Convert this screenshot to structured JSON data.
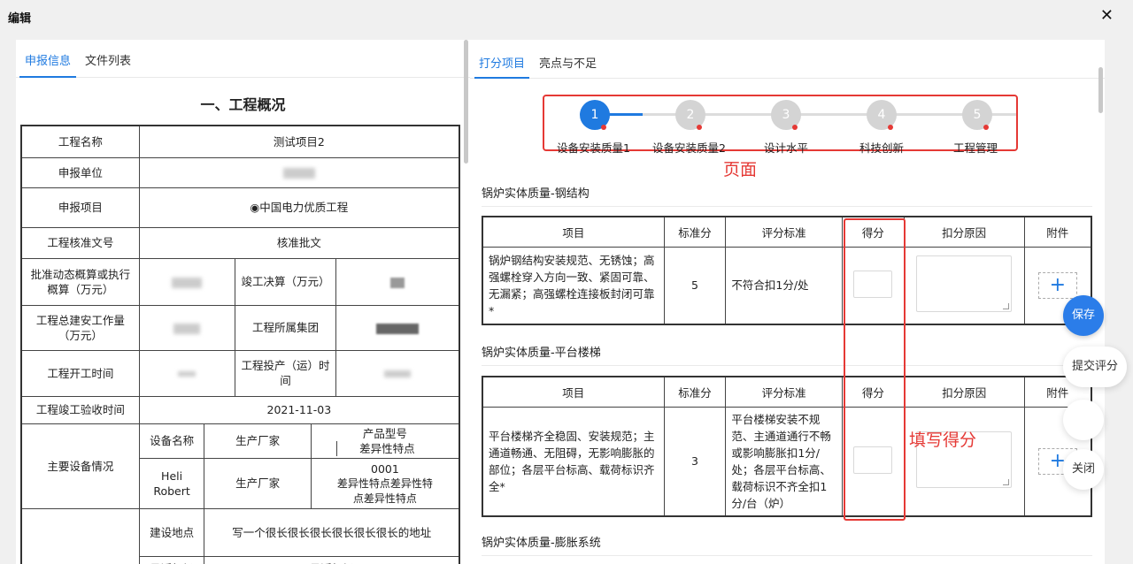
{
  "window": {
    "title": "编辑",
    "close_symbol": "✕"
  },
  "left": {
    "tabs": [
      "申报信息",
      "文件列表"
    ],
    "section_title": "一、工程概况",
    "rows": {
      "project_name_label": "工程名称",
      "project_name_value": "测试项目2",
      "unit_label": "申报单位",
      "item_label": "申报项目",
      "item_value": "◉中国电力优质工程",
      "doc_label": "工程核准文号",
      "doc_value": "核准批文",
      "budget_label": "批准动态概算或执行概算（万元）",
      "final_label": "竣工决算（万元）",
      "workload_label": "工程总建安工作量（万元）",
      "group_label": "工程所属集团",
      "start_label": "工程开工时间",
      "production_label": "工程投产（运）时间",
      "accept_label": "工程竣工验收时间",
      "accept_value": "2021-11-03",
      "equipment_label": "主要设备情况",
      "equip_headers": [
        "设备名称",
        "生产厂家",
        "产品型号",
        "差异性特点"
      ],
      "equip_row": [
        "Heli Robert",
        "生产厂家",
        "0001",
        "差异性特点差异性特点差异性特点"
      ],
      "site_label": "建设地点",
      "site_value": "写一个很长很长很长很长很长很长的地址",
      "airport_label": "最近机场",
      "airport_value": "最近机场"
    }
  },
  "right": {
    "tabs": [
      "打分项目",
      "亮点与不足"
    ],
    "steps": [
      {
        "num": "1",
        "label": "设备安装质量1",
        "active": true
      },
      {
        "num": "2",
        "label": "设备安装质量2",
        "active": false
      },
      {
        "num": "3",
        "label": "设计水平",
        "active": false
      },
      {
        "num": "4",
        "label": "科技创新",
        "active": false
      },
      {
        "num": "5",
        "label": "工程管理",
        "active": false
      }
    ],
    "annotation_page": "页面",
    "annotation_fill": "填写得分",
    "table_headers": [
      "项目",
      "标准分",
      "评分标准",
      "得分",
      "扣分原因",
      "附件"
    ],
    "groups": [
      {
        "title": "锅炉实体质量-钢结构",
        "requirement": "锅炉钢结构安装规范、无锈蚀；高强螺栓穿入方向一致、紧固可靠、无漏紧；高强螺栓连接板封闭可靠*",
        "standard_score": "5",
        "criteria": "不符合扣1分/处"
      },
      {
        "title": "锅炉实体质量-平台楼梯",
        "requirement": "平台楼梯齐全稳固、安装规范；主通道畅通、无阻碍，无影响膨胀的部位；各层平台标高、载荷标识齐全*",
        "standard_score": "3",
        "criteria": "平台楼梯安装不规范、主通道通行不畅或影响膨胀扣1分/处；各层平台标高、载荷标识不齐全扣1分/台（炉）"
      }
    ],
    "next_group_title": "锅炉实体质量-膨胀系统",
    "plus": "+"
  },
  "actions": {
    "save": "保存",
    "submit": "提交评分",
    "close": "关闭"
  }
}
